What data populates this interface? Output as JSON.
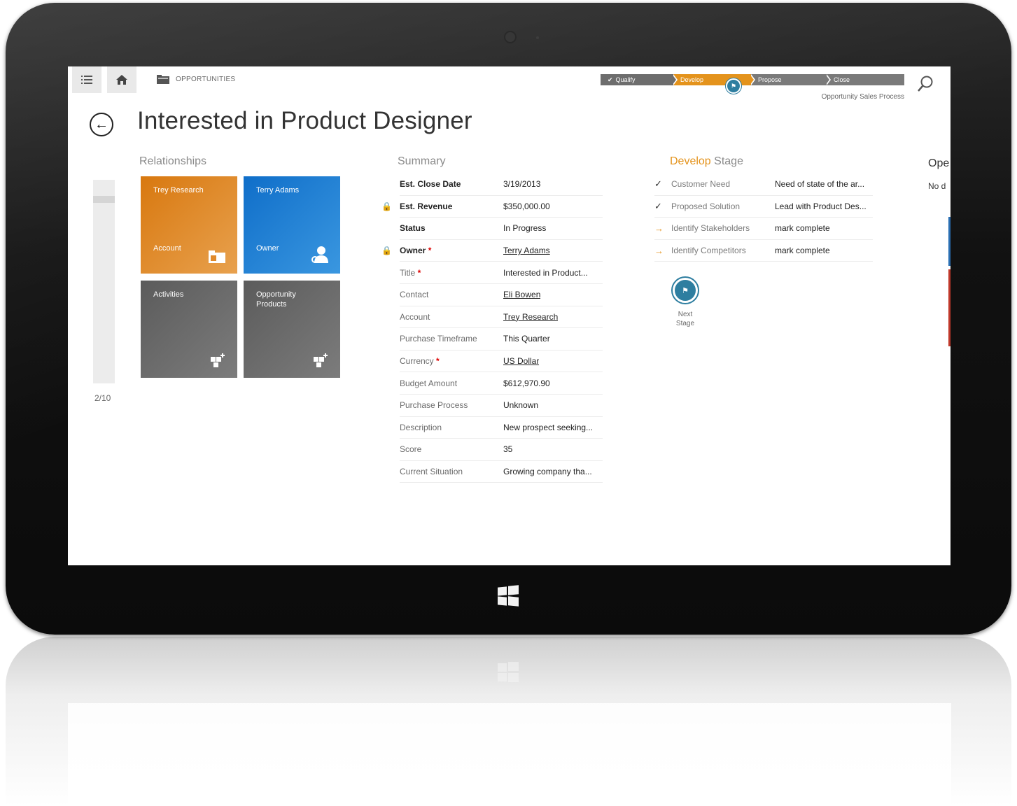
{
  "nav": {
    "area_label": "OPPORTUNITIES"
  },
  "process": {
    "stages": [
      "Qualify",
      "Develop",
      "Propose",
      "Close"
    ],
    "active_stage": "Develop",
    "name": "Opportunity Sales Process"
  },
  "record": {
    "title": "Interested in Product Designer"
  },
  "relationships": {
    "heading": "Relationships",
    "pager": "2/10",
    "tiles": [
      {
        "top": "Trey Research",
        "bottom": "Account",
        "color": "#d8780f",
        "icon": "account-card-icon"
      },
      {
        "top": "Terry Adams",
        "bottom": "Owner",
        "color": "#0f6ec9",
        "icon": "user-icon"
      },
      {
        "top": "Activities",
        "bottom": "",
        "color": "#5b5b5b",
        "icon": "add-tiles-icon"
      },
      {
        "top": "Opportunity Products",
        "bottom": "",
        "color": "#5b5b5b",
        "icon": "add-tiles-icon"
      }
    ]
  },
  "summary": {
    "heading": "Summary",
    "rows": [
      {
        "label": "Est. Close Date",
        "value": "3/19/2013"
      },
      {
        "label": "Est. Revenue",
        "value": "$350,000.00"
      },
      {
        "label": "Status",
        "value": "In Progress"
      },
      {
        "label": "Owner",
        "value": "Terry Adams"
      },
      {
        "label": "Title",
        "value": "Interested in Product..."
      },
      {
        "label": "Contact",
        "value": "Eli Bowen"
      },
      {
        "label": "Account",
        "value": "Trey Research"
      },
      {
        "label": "Purchase Timeframe",
        "value": "This Quarter"
      },
      {
        "label": "Currency",
        "value": "US Dollar"
      },
      {
        "label": "Budget Amount",
        "value": "$612,970.90"
      },
      {
        "label": "Purchase Process",
        "value": "Unknown"
      },
      {
        "label": "Description",
        "value": "New prospect seeking..."
      },
      {
        "label": "Score",
        "value": "35"
      },
      {
        "label": "Current Situation",
        "value": "Growing company tha..."
      }
    ]
  },
  "develop_stage": {
    "heading_accent": "Develop",
    "heading_rest": " Stage",
    "steps": [
      {
        "label": "Customer Need",
        "value": "Need of state of the ar...",
        "status": "done"
      },
      {
        "label": "Proposed Solution",
        "value": "Lead with Product Des...",
        "status": "done"
      },
      {
        "label": "Identify Stakeholders",
        "value": "mark complete",
        "status": "pending"
      },
      {
        "label": "Identify Competitors",
        "value": "mark complete",
        "status": "pending"
      }
    ],
    "next_label_1": "Next",
    "next_label_2": "Stage"
  },
  "open": {
    "heading": "Ope",
    "sub": "No d"
  },
  "colors": {
    "accent_orange": "#e4931c",
    "flag_teal": "#2e7ea0",
    "required_red": "#dd0000"
  }
}
